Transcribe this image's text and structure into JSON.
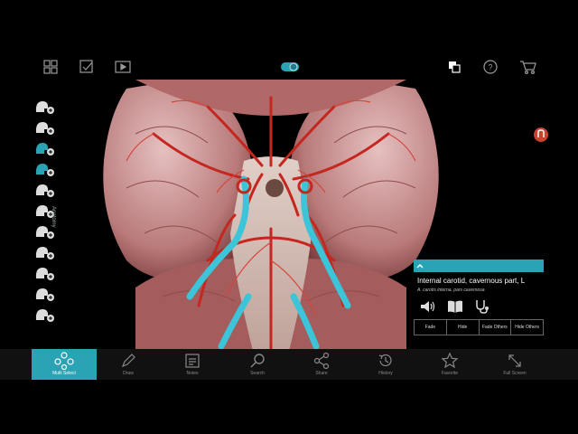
{
  "colors": {
    "accent": "#2aa3b5",
    "artery": "#c4271f",
    "highlight": "#3cc4d8",
    "tissue": "#c98a8a"
  },
  "topbar": {
    "icons": [
      "grid-icon",
      "checklist-icon",
      "video-icon",
      "toggle-icon",
      "layers-icon",
      "help-icon",
      "cart-icon"
    ]
  },
  "sidebar": {
    "label": "Anatomy",
    "items": [
      "head-add-icon",
      "head-add-icon",
      "head-add-icon",
      "head-add-icon",
      "head-add-icon",
      "head-add-icon",
      "head-add-icon",
      "head-add-icon",
      "head-add-icon",
      "head-add-icon",
      "head-add-icon"
    ]
  },
  "badge": {
    "text": ""
  },
  "viewport": {
    "subject": "brain-arteries-3d-model"
  },
  "info_panel": {
    "title": "Internal carotid, cavernous part, L",
    "subtitle": "A. carotis interna, pars cavernosa",
    "actions": [
      "Fade",
      "Hide",
      "Fade Others",
      "Hide Others"
    ]
  },
  "bottombar": {
    "tools": [
      {
        "label": "Multi Select",
        "icon": "multiselect-icon"
      },
      {
        "label": "Draw",
        "icon": "pencil-icon"
      },
      {
        "label": "Notes",
        "icon": "notes-icon"
      },
      {
        "label": "Search",
        "icon": "search-icon"
      },
      {
        "label": "Share",
        "icon": "share-icon"
      },
      {
        "label": "History",
        "icon": "history-icon"
      },
      {
        "label": "Favorite",
        "icon": "star-icon"
      },
      {
        "label": "Full Screen",
        "icon": "fullscreen-icon"
      }
    ]
  }
}
